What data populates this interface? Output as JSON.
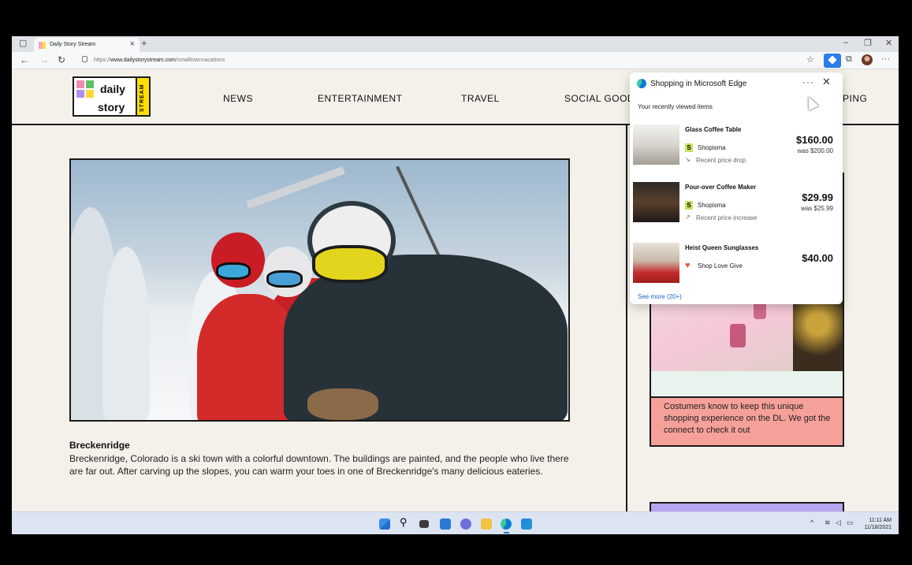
{
  "browser": {
    "tab_title": "Daily Story Stream",
    "tab_close": "×",
    "new_tab": "+",
    "url_prefix": "https://",
    "url_host": "www.dailystorystream.com",
    "url_path": "/smalltownvacations",
    "window_controls": [
      "–",
      "❐",
      "✕"
    ],
    "more": "···",
    "accent": "#2b7de9"
  },
  "site": {
    "logo": {
      "line1": "daily",
      "line2": "story",
      "badge": "STREAM"
    },
    "nav": [
      "NEWS",
      "ENTERTAINMENT",
      "TRAVEL",
      "SOCIAL GOOD",
      "PING"
    ],
    "article": {
      "title": "Breckenridge",
      "body": "Breckenridge, Colorado is a ski town with a colorful downtown. The buildings are painted, and the people who live there are far out. After carving up the slopes, you can warm your toes in one of Breckenridge's many delicious eateries."
    },
    "side_card": {
      "caption": "Costumers know to keep this unique shopping experience on the DL. We got the connect to check it out"
    }
  },
  "shopping_panel": {
    "title": "Shopping in Microsoft Edge",
    "more": "···",
    "close": "✕",
    "subtitle": "Your recently viewed items",
    "items": [
      {
        "name": "Glass Coffee Table",
        "store": "Shopisma",
        "note": "Recent price drop",
        "price": "$160.00",
        "was": "was $200.00",
        "icon": "shopisma-logo-icon",
        "note_icon": "price-drop-icon"
      },
      {
        "name": "Pour-over Coffee Maker",
        "store": "Shopisma",
        "note": "Recent price increase",
        "price": "$29.99",
        "was": "was $25.99",
        "icon": "shopisma-logo-icon",
        "note_icon": "price-increase-icon"
      },
      {
        "name": "Heist Queen Sunglasses",
        "store": "Shop Love Give",
        "note": "",
        "price": "$40.00",
        "was": "",
        "icon": "heart-icon",
        "note_icon": ""
      }
    ],
    "store_logo_letter": "S",
    "see_more": "See more (20+)"
  },
  "taskbar": {
    "apps": [
      "start-icon",
      "search-icon",
      "task-view-icon",
      "widgets-icon",
      "chat-icon",
      "file-explorer-icon",
      "edge-icon",
      "store-icon"
    ],
    "clock_time": "11:11 AM",
    "clock_date": "11/18/2021"
  }
}
